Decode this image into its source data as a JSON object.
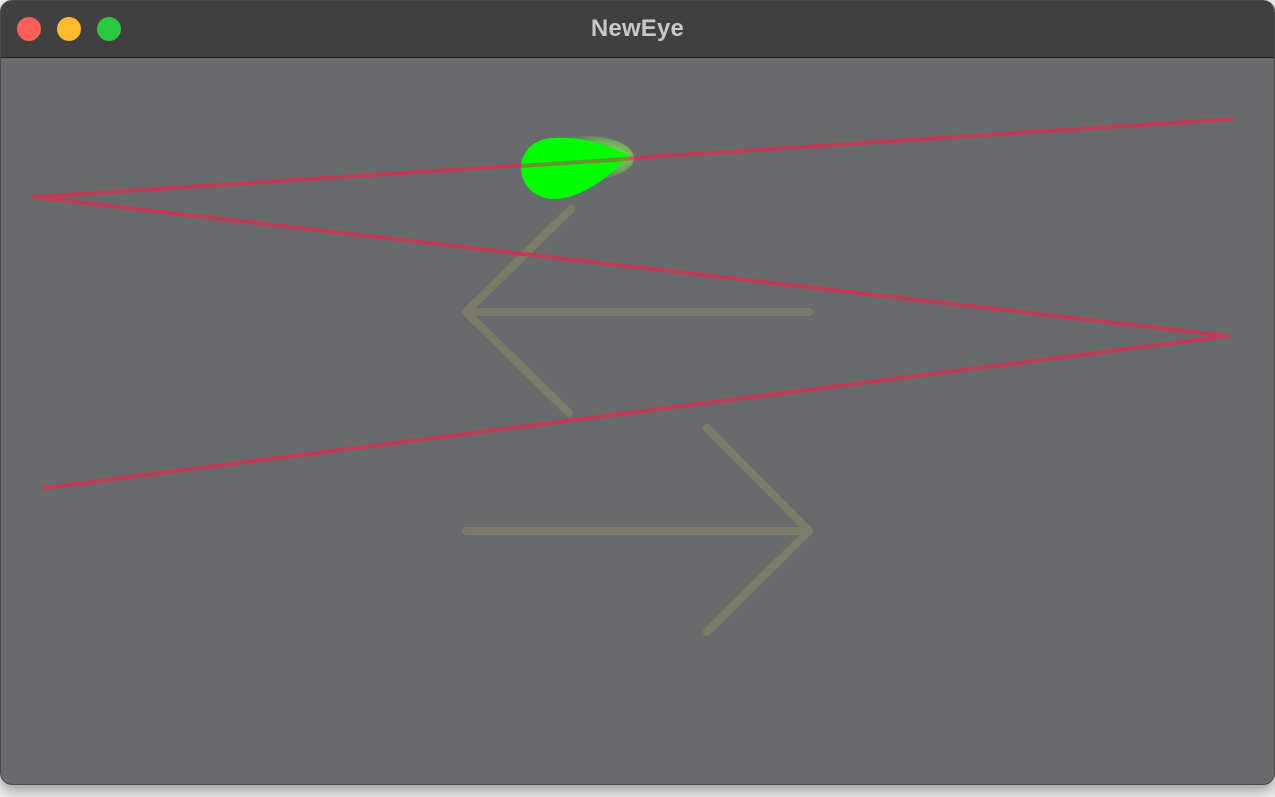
{
  "window": {
    "title": "NewEye",
    "controls": [
      {
        "name": "close",
        "color": "#fe5f57"
      },
      {
        "name": "minimize",
        "color": "#febc2e"
      },
      {
        "name": "zoom",
        "color": "#28c840"
      }
    ]
  },
  "canvas": {
    "background_color": "#686b6c",
    "arrows": [
      {
        "direction": "left",
        "color": "#7c7b6a"
      },
      {
        "direction": "right",
        "color": "#7c7b6a"
      }
    ],
    "gaze_path": {
      "color": "#c43a55"
    },
    "gaze_marker": {
      "shape": "teardrop",
      "color": "#00ff00"
    }
  }
}
